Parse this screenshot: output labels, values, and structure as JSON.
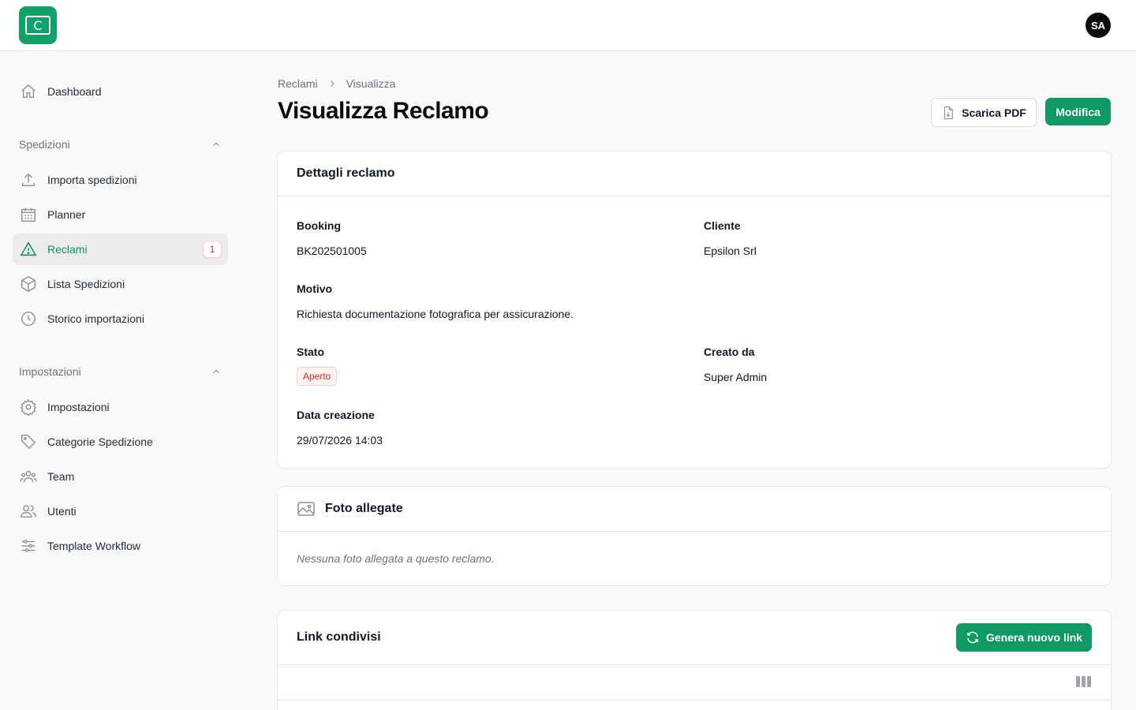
{
  "app": {
    "logo_letter": "C",
    "user_initials": "SA"
  },
  "sidebar": {
    "dashboard": {
      "label": "Dashboard",
      "icon": "home-icon"
    },
    "sections": [
      {
        "title": "Spedizioni",
        "items": [
          {
            "label": "Importa spedizioni",
            "icon": "upload-icon"
          },
          {
            "label": "Planner",
            "icon": "calendar-icon"
          },
          {
            "label": "Reclami",
            "icon": "warning-icon",
            "active": true,
            "badge": "1"
          },
          {
            "label": "Lista Spedizioni",
            "icon": "box-icon"
          },
          {
            "label": "Storico importazioni",
            "icon": "clock-icon"
          }
        ]
      },
      {
        "title": "Impostazioni",
        "items": [
          {
            "label": "Impostazioni",
            "icon": "gear-icon"
          },
          {
            "label": "Categorie Spedizione",
            "icon": "tag-icon"
          },
          {
            "label": "Team",
            "icon": "team-icon"
          },
          {
            "label": "Utenti",
            "icon": "users-icon"
          },
          {
            "label": "Template Workflow",
            "icon": "sliders-icon"
          }
        ]
      }
    ]
  },
  "breadcrumb": {
    "parent": "Reclami",
    "current": "Visualizza"
  },
  "page": {
    "title": "Visualizza Reclamo",
    "pdf_button": "Scarica PDF",
    "edit_button": "Modifica"
  },
  "details": {
    "title": "Dettagli reclamo",
    "booking_label": "Booking",
    "booking_value": "BK202501005",
    "client_label": "Cliente",
    "client_value": "Epsilon Srl",
    "reason_label": "Motivo",
    "reason_value": "Richiesta documentazione fotografica per assicurazione.",
    "status_label": "Stato",
    "status_value": "Aperto",
    "created_by_label": "Creato da",
    "created_by_value": "Super Admin",
    "created_date_label": "Data creazione",
    "created_date_value": "29/07/2026 14:03"
  },
  "photos": {
    "title": "Foto allegate",
    "empty_text": "Nessuna foto allegata a questo reclamo."
  },
  "links": {
    "title": "Link condivisi",
    "generate_button": "Genera nuovo link"
  },
  "colors": {
    "brand": "#0f9a63",
    "danger": "#dc2626"
  }
}
